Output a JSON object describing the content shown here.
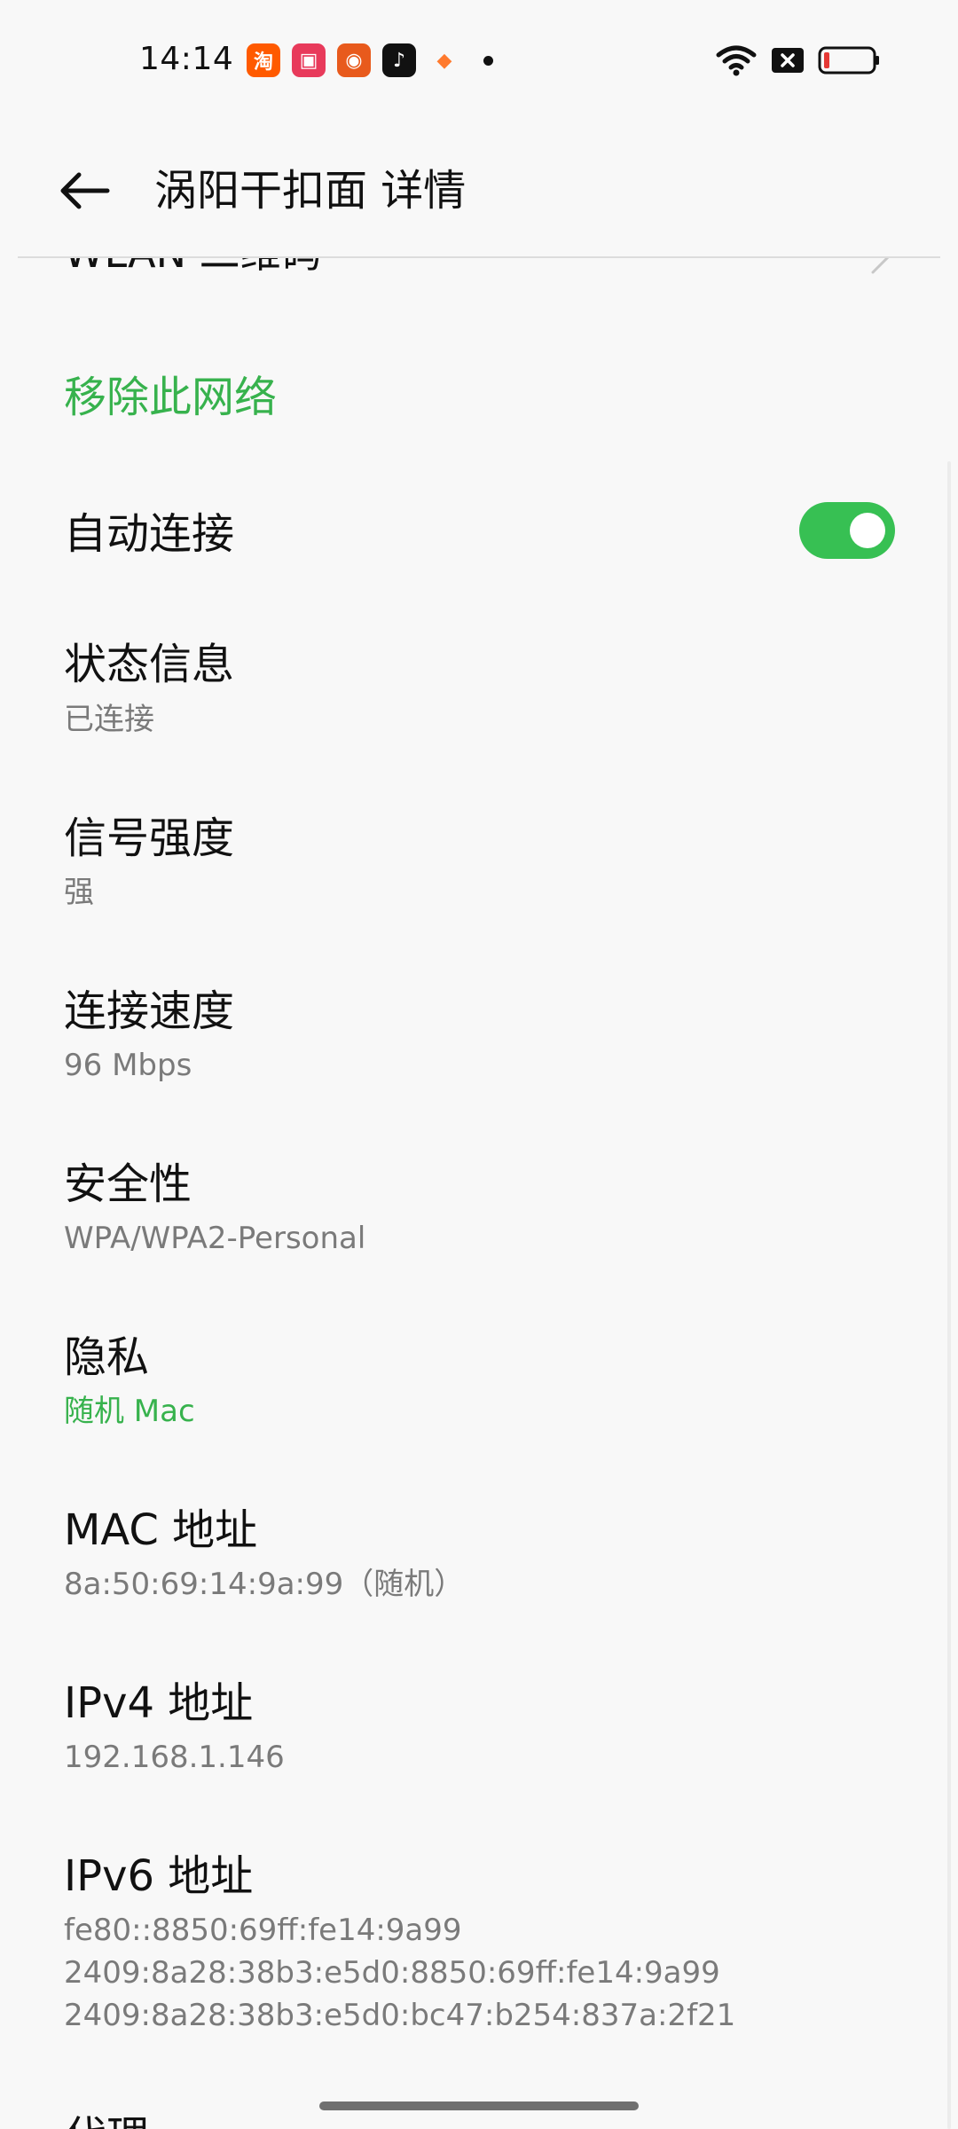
{
  "status_bar": {
    "time": "14:14",
    "notification_icons": [
      {
        "name": "taobao-app-icon",
        "glyph": "淘",
        "color": "#ff5a00"
      },
      {
        "name": "video-app-icon",
        "glyph": "▣",
        "color": "#e83a5b"
      },
      {
        "name": "pumpkin-app-icon",
        "glyph": "◉",
        "color": "#e85a1c"
      },
      {
        "name": "tiktok-app-icon",
        "glyph": "♪",
        "color": "#111111"
      },
      {
        "name": "game-app-icon",
        "glyph": "◆",
        "color": "#ff7a2e"
      }
    ]
  },
  "header": {
    "title": "涡阳干扣面 详情"
  },
  "partial_row": {
    "label": "WLAN 二维码"
  },
  "remove_network": {
    "label": "移除此网络"
  },
  "auto_connect": {
    "label": "自动连接",
    "enabled": true
  },
  "info_rows": [
    {
      "key": "status",
      "title": "状态信息",
      "value": "已连接"
    },
    {
      "key": "signal",
      "title": "信号强度",
      "value": "强"
    },
    {
      "key": "speed",
      "title": "连接速度",
      "value": "96 Mbps"
    },
    {
      "key": "security",
      "title": "安全性",
      "value": "WPA/WPA2-Personal"
    },
    {
      "key": "privacy",
      "title": "隐私",
      "value": "随机 Mac"
    },
    {
      "key": "mac",
      "title": "MAC 地址",
      "value": "8a:50:69:14:9a:99（随机）"
    },
    {
      "key": "ipv4",
      "title": "IPv4 地址",
      "value": "192.168.1.146"
    },
    {
      "key": "ipv6",
      "title": "IPv6 地址",
      "value": "fe80::8850:69ff:fe14:9a99\n2409:8a28:38b3:e5d0:8850:69ff:fe14:9a99\n2409:8a28:38b3:e5d0:bc47:b254:837a:2f21"
    },
    {
      "key": "proxy",
      "title": "代理",
      "value": ""
    }
  ],
  "colors": {
    "accent": "#37b24d",
    "toggle_on": "#37c053",
    "background": "#f8f8f8"
  }
}
